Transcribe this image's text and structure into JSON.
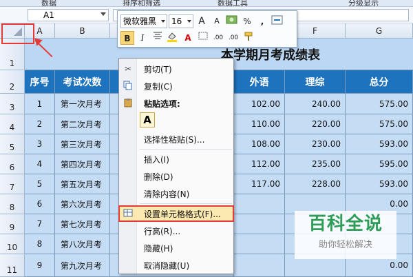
{
  "ribbon": {
    "items": [
      "数据",
      "排序和筛选",
      "数据工具",
      "分级显示"
    ]
  },
  "formula_bar": {
    "name_box": "A1"
  },
  "columns": [
    "A",
    "B",
    "C",
    "D",
    "E",
    "F",
    "G"
  ],
  "rows": [
    "1",
    "2",
    "3",
    "4",
    "5",
    "6",
    "7",
    "8",
    "9",
    "10",
    "11"
  ],
  "sheet": {
    "title": "本学期月考成绩表",
    "headers": [
      "序号",
      "考试次数",
      "外语",
      "理综",
      "总分"
    ],
    "data": [
      {
        "no": "1",
        "exam": "第一次月考",
        "foreign": "102.00",
        "sci": "240.00",
        "total": "575.00"
      },
      {
        "no": "2",
        "exam": "第二次月考",
        "foreign": "110.00",
        "sci": "220.00",
        "total": "575.00"
      },
      {
        "no": "3",
        "exam": "第三次月考",
        "foreign": "108.00",
        "sci": "230.00",
        "total": "593.00"
      },
      {
        "no": "4",
        "exam": "第四次月考",
        "foreign": "112.00",
        "sci": "235.00",
        "total": "595.00"
      },
      {
        "no": "5",
        "exam": "第五次月考",
        "foreign": "117.00",
        "sci": "228.00",
        "total": "593.00"
      },
      {
        "no": "6",
        "exam": "第六次月考",
        "foreign": "",
        "sci": "",
        "total": "0.00"
      },
      {
        "no": "7",
        "exam": "第七次月考",
        "foreign": "",
        "sci": "",
        "total": ""
      },
      {
        "no": "8",
        "exam": "第八次月考",
        "foreign": "",
        "sci": "",
        "total": ""
      },
      {
        "no": "9",
        "exam": "第九次月考",
        "foreign": "",
        "sci": "",
        "total": "0.00"
      }
    ]
  },
  "mini_toolbar": {
    "font": "微软雅黑",
    "size": "16",
    "grow": "A",
    "shrink": "A",
    "percent": "%",
    "comma": ",",
    "bold": "B",
    "italic": "I",
    "font_color": "A",
    "dec_inc": ".00",
    "dec_dec": ".00"
  },
  "context_menu": {
    "items": [
      "剪切(T)",
      "复制(C)",
      "粘贴选项:",
      "选择性粘贴(S)...",
      "插入(I)",
      "删除(D)",
      "清除内容(N)",
      "设置单元格格式(F)...",
      "行高(R)...",
      "隐藏(H)",
      "取消隐藏(U)"
    ],
    "paste_icon": "A"
  },
  "watermark": {
    "title": "百科全说",
    "subtitle": "助你轻松解决"
  },
  "colors": {
    "header_blue": "#1e73be",
    "cell_blue": "#c5dcf5",
    "highlight_red": "#e53935",
    "watermark_green": "#2f9d57"
  }
}
